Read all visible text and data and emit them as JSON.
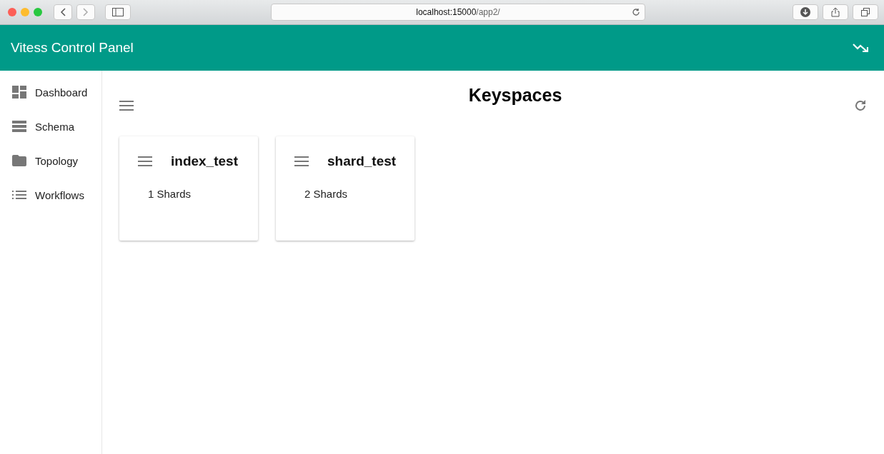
{
  "browser": {
    "url_host": "localhost:15000",
    "url_path": "/app2/"
  },
  "app_bar": {
    "title": "Vitess Control Panel"
  },
  "sidebar": {
    "items": [
      {
        "label": "Dashboard",
        "kind": "dashboard"
      },
      {
        "label": "Schema",
        "kind": "schema"
      },
      {
        "label": "Topology",
        "kind": "folder"
      },
      {
        "label": "Workflows",
        "kind": "list"
      }
    ]
  },
  "page": {
    "title": "Keyspaces"
  },
  "keyspaces": [
    {
      "name": "index_test",
      "shards": "1 Shards"
    },
    {
      "name": "shard_test",
      "shards": "2 Shards"
    }
  ]
}
